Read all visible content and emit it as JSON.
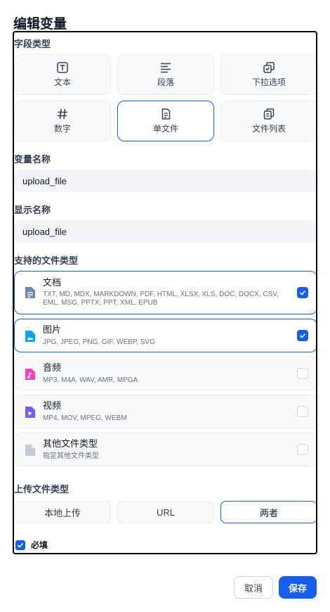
{
  "dialog": {
    "title": "编辑变量"
  },
  "field_type": {
    "label": "字段类型",
    "options": [
      {
        "label": "文本",
        "icon": "text-icon",
        "selected": false
      },
      {
        "label": "段落",
        "icon": "paragraph-icon",
        "selected": false
      },
      {
        "label": "下拉选项",
        "icon": "select-icon",
        "selected": false
      },
      {
        "label": "数字",
        "icon": "number-icon",
        "selected": false
      },
      {
        "label": "单文件",
        "icon": "single-file-icon",
        "selected": true
      },
      {
        "label": "文件列表",
        "icon": "file-list-icon",
        "selected": false
      }
    ]
  },
  "variable_name": {
    "label": "变量名称",
    "value": "upload_file"
  },
  "display_name": {
    "label": "显示名称",
    "value": "upload_file"
  },
  "file_types": {
    "label": "支持的文件类型",
    "items": [
      {
        "name": "文档",
        "exts": "TXT, MD, MDX, MARKDOWN, PDF, HTML, XLSX, XLS, DOC, DOCX, CSV, EML, MSG, PPTX, PPT, XML, EPUB",
        "checked": true,
        "color": "#6e86b0"
      },
      {
        "name": "图片",
        "exts": "JPG, JPEG, PNG, GIF, WEBP, SVG",
        "checked": true,
        "color": "#0ba5ec"
      },
      {
        "name": "音频",
        "exts": "MP3, M4A, WAV, AMR, MPGA",
        "checked": false,
        "color": "#ee46bc"
      },
      {
        "name": "视频",
        "exts": "MP4, MOV, MPEG, WEBM",
        "checked": false,
        "color": "#7a5af8"
      },
      {
        "name": "其他文件类型",
        "exts": "指定其他文件类型",
        "checked": false,
        "color": "#c5cad8"
      }
    ]
  },
  "upload_method": {
    "label": "上传文件类型",
    "options": [
      {
        "label": "本地上传",
        "selected": false
      },
      {
        "label": "URL",
        "selected": false
      },
      {
        "label": "两者",
        "selected": true
      }
    ]
  },
  "required": {
    "label": "必填",
    "checked": true
  },
  "footer": {
    "cancel": "取消",
    "save": "保存"
  },
  "colors": {
    "accent": "#155eef",
    "border": "#eaecf0",
    "card_bg": "#f9fafb"
  }
}
